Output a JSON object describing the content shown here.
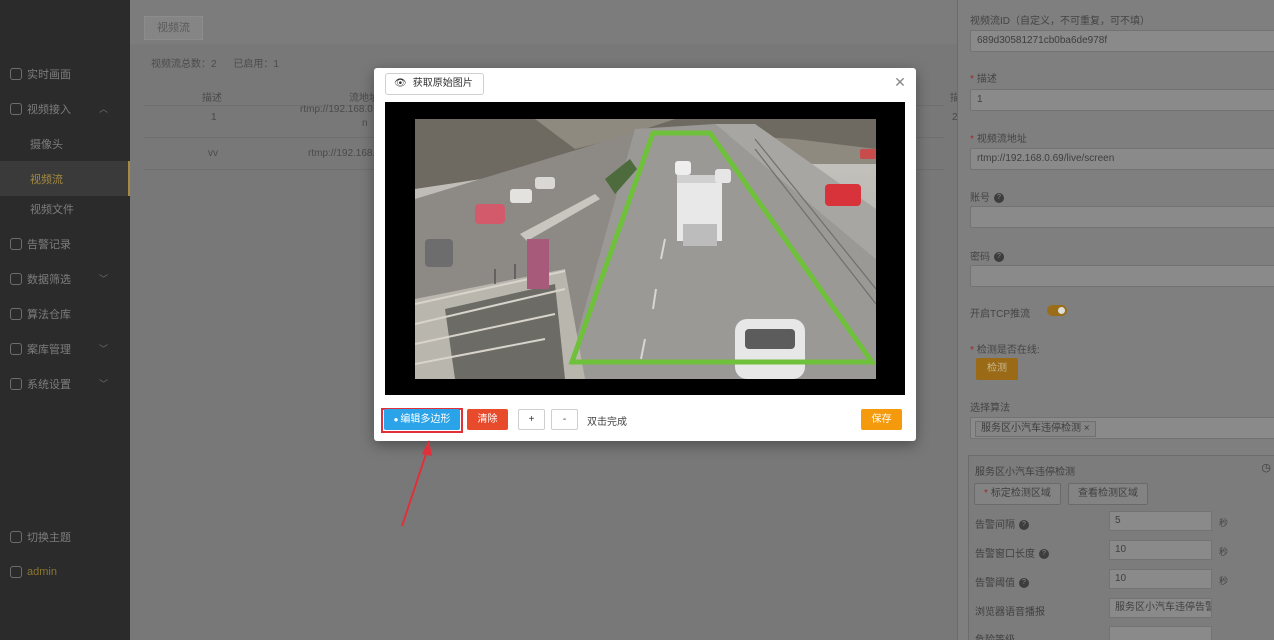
{
  "sidebar": {
    "items": [
      {
        "label": "实时画面"
      },
      {
        "label": "视频接入"
      },
      {
        "label": "摄像头"
      },
      {
        "label": "视频流"
      },
      {
        "label": "视频文件"
      },
      {
        "label": "告警记录"
      },
      {
        "label": "数据筛选"
      },
      {
        "label": "算法仓库"
      },
      {
        "label": "案库管理"
      },
      {
        "label": "系统设置"
      }
    ],
    "theme_label": "切换主题",
    "user": "admin"
  },
  "main": {
    "tab": "视频流",
    "stats": {
      "total": "视频流总数：2",
      "enabled": "已启用：1"
    },
    "table": {
      "headers": [
        "描述",
        "流地址"
      ],
      "rows": [
        {
          "desc": "1",
          "url": "rtmp://192.168.0.",
          "url2": "n"
        },
        {
          "desc": "vv",
          "url": "rtmp://192.168.:",
          "url2": ""
        }
      ],
      "extra_col_head": "描",
      "extra_col_val": "2"
    }
  },
  "modal": {
    "get_image_btn": "获取原始图片",
    "edit_polygon_btn": "编辑多边形",
    "clear_btn": "清除",
    "plus_btn": "+",
    "minus_btn": "-",
    "hint": "双击完成",
    "save_btn": "保存",
    "polygon_color": "#6fc13b"
  },
  "drawer": {
    "stream_id_label": "视频流ID（自定义，不可重复，可不填）",
    "stream_id_value": "689d30581271cb0ba6de978f",
    "desc_label": "描述",
    "desc_value": "1",
    "url_label": "视频流地址",
    "url_value": "rtmp://192.168.0.69/live/screen",
    "account_label": "账号",
    "password_label": "密码",
    "tcp_label": "开启TCP推流",
    "online_label": "检测是否在线:",
    "detect_btn": "检测",
    "algo_label": "选择算法",
    "algo_chip": "服务区小汽车违停检测",
    "algo_card": {
      "title": "服务区小汽车违停检测",
      "mark_btn": "标定检测区域",
      "view_btn": "查看检测区域",
      "params": [
        {
          "label": "告警间隔",
          "value": "5",
          "unit": "秒",
          "help": true
        },
        {
          "label": "告警窗口长度",
          "value": "10",
          "unit": "秒",
          "help": true
        },
        {
          "label": "告警阈值",
          "value": "10",
          "unit": "秒",
          "help": true
        },
        {
          "label": "浏览器语音播报",
          "value": "服务区小汽车违停告警",
          "unit": "",
          "help": false
        },
        {
          "label": "危险等级",
          "value": "",
          "unit": "",
          "help": false
        }
      ]
    }
  }
}
